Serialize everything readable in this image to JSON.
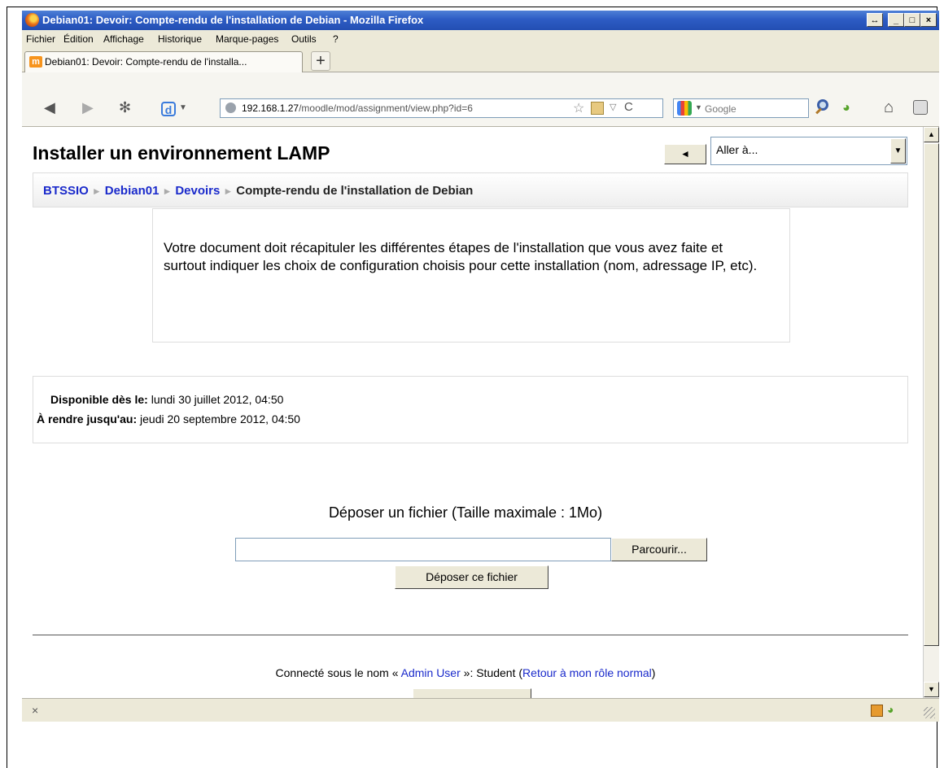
{
  "window": {
    "title": "Debian01: Devoir: Compte-rendu de l'installation de Debian - Mozilla Firefox",
    "controls": {
      "restore": "↔",
      "minimize": "_",
      "maximize": "□",
      "close": "×"
    }
  },
  "menubar": {
    "items": [
      "Fichier",
      "Édition",
      "Affichage",
      "Historique",
      "Marque-pages",
      "Outils",
      "?"
    ]
  },
  "tabs": [
    {
      "label": "Debian01: Devoir: Compte-rendu de l'installa...",
      "icon": "moodle-icon",
      "active": true
    }
  ],
  "new_tab_label": "+",
  "urlbar": {
    "host": "192.168.1.27",
    "path": "/moodle/mod/assignment/view.php?id=6"
  },
  "search": {
    "placeholder": "Google"
  },
  "page": {
    "heading": "Installer un environnement LAMP",
    "prev_button": "◄",
    "jump_select": {
      "value": "Aller à...",
      "drop_arrow": "▼"
    },
    "breadcrumb": {
      "items": [
        "BTSSIO",
        "Debian01",
        "Devoirs"
      ],
      "current": "Compte-rendu de l'installation de Debian",
      "separator": "►"
    },
    "description": "Votre document doit récapituler les différentes étapes de l'installation que vous avez faite et surtout indiquer les choix de configuration choisis pour cette installation (nom, adressage IP, etc).",
    "dates": [
      {
        "label": "Disponible dès le:",
        "value": "lundi 30 juillet 2012, 04:50"
      },
      {
        "label": "À rendre jusqu'au:",
        "value": "jeudi 20 septembre 2012, 04:50"
      }
    ],
    "upload": {
      "title": "Déposer un fichier (Taille maximale : 1Mo)",
      "browse_label": "Parcourir...",
      "submit_label": "Déposer ce fichier"
    },
    "footer": {
      "prefix": "Connecté sous le nom «",
      "user": "Admin User",
      "middle": "»: Student (",
      "role_link": "Retour à mon rôle normal",
      "suffix": ")"
    }
  },
  "statusbar": {
    "close_label": "×"
  },
  "colors": {
    "link": "#1a2acb",
    "titlebar": "#2d5cc4",
    "chrome": "#ECE9D8"
  }
}
